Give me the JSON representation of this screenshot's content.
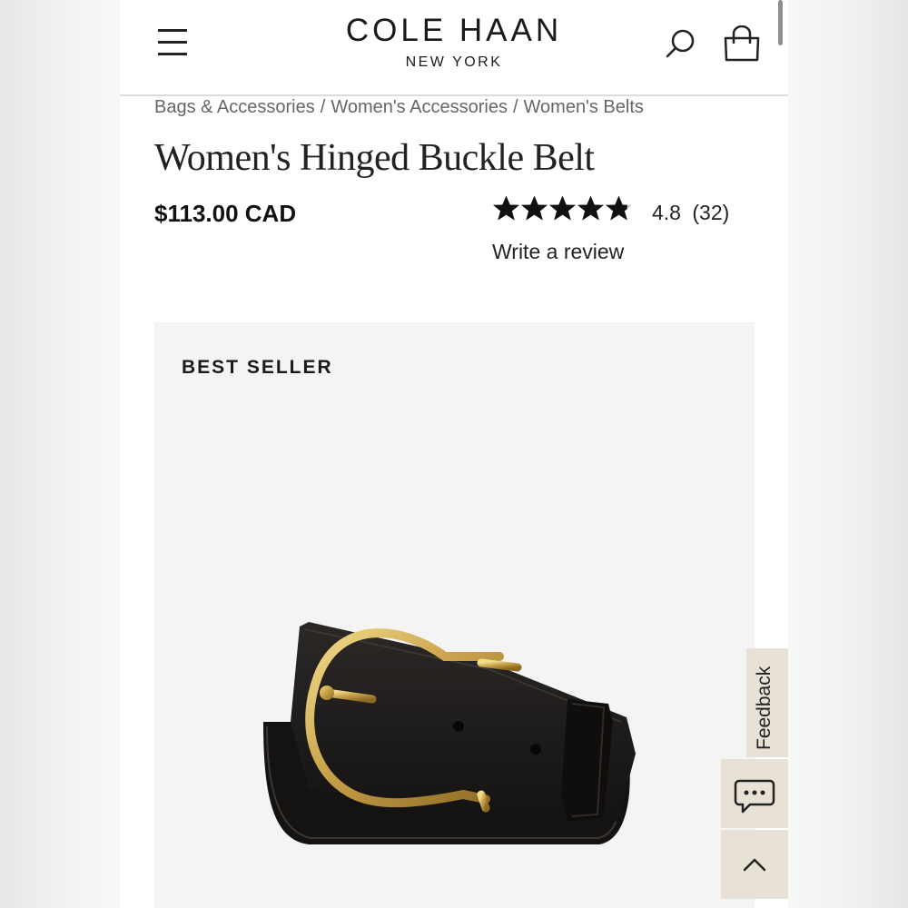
{
  "header": {
    "brand_name": "COLE HAAN",
    "brand_sub": "NEW YORK",
    "menu_icon": "hamburger-menu-icon",
    "search_icon": "search-icon",
    "bag_icon": "shopping-bag-icon"
  },
  "breadcrumb": {
    "items": [
      "Bags & Accessories",
      "Women's Accessories",
      "Women's Belts"
    ],
    "separator": "/"
  },
  "product": {
    "title": "Women's Hinged Buckle Belt",
    "price": "$113.00 CAD",
    "rating": {
      "value": 4.8,
      "stars_max": 5,
      "text": "4.8",
      "count": "(32)"
    },
    "write_review": "Write a review",
    "badge": "BEST SELLER",
    "image_colors": {
      "background": "#f4f4f4",
      "leather": "#1c1a19",
      "buckle": "#c9a64a"
    }
  },
  "widgets": {
    "feedback_label": "Feedback",
    "chat_icon": "chat-bubble-icon",
    "back_to_top_icon": "chevron-up-icon",
    "widget_color": "#e8e2d6"
  }
}
